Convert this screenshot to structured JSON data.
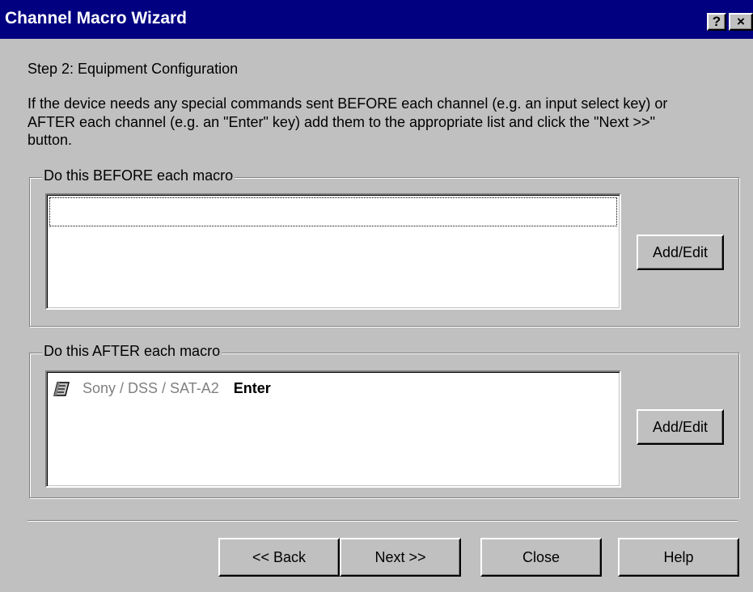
{
  "window": {
    "title": "Channel Macro Wizard",
    "help_button": "?",
    "close_button": "×"
  },
  "step": {
    "heading": "Step 2: Equipment Configuration",
    "instructions": "If the device needs any special commands sent BEFORE each channel (e.g. an input select key) or AFTER each channel (e.g. an \"Enter\" key) add them to the appropriate list and click the \"Next >>\" button."
  },
  "before_group": {
    "label": "Do this BEFORE each macro",
    "items": [],
    "add_edit_label": "Add/Edit"
  },
  "after_group": {
    "label": "Do this AFTER each macro",
    "items": [
      {
        "icon": "remote-control-icon",
        "device": "Sony / DSS / SAT-A2",
        "command": "Enter"
      }
    ],
    "add_edit_label": "Add/Edit"
  },
  "footer": {
    "back_label": "<< Back",
    "next_label": "Next >>",
    "close_label": "Close",
    "help_label": "Help"
  }
}
